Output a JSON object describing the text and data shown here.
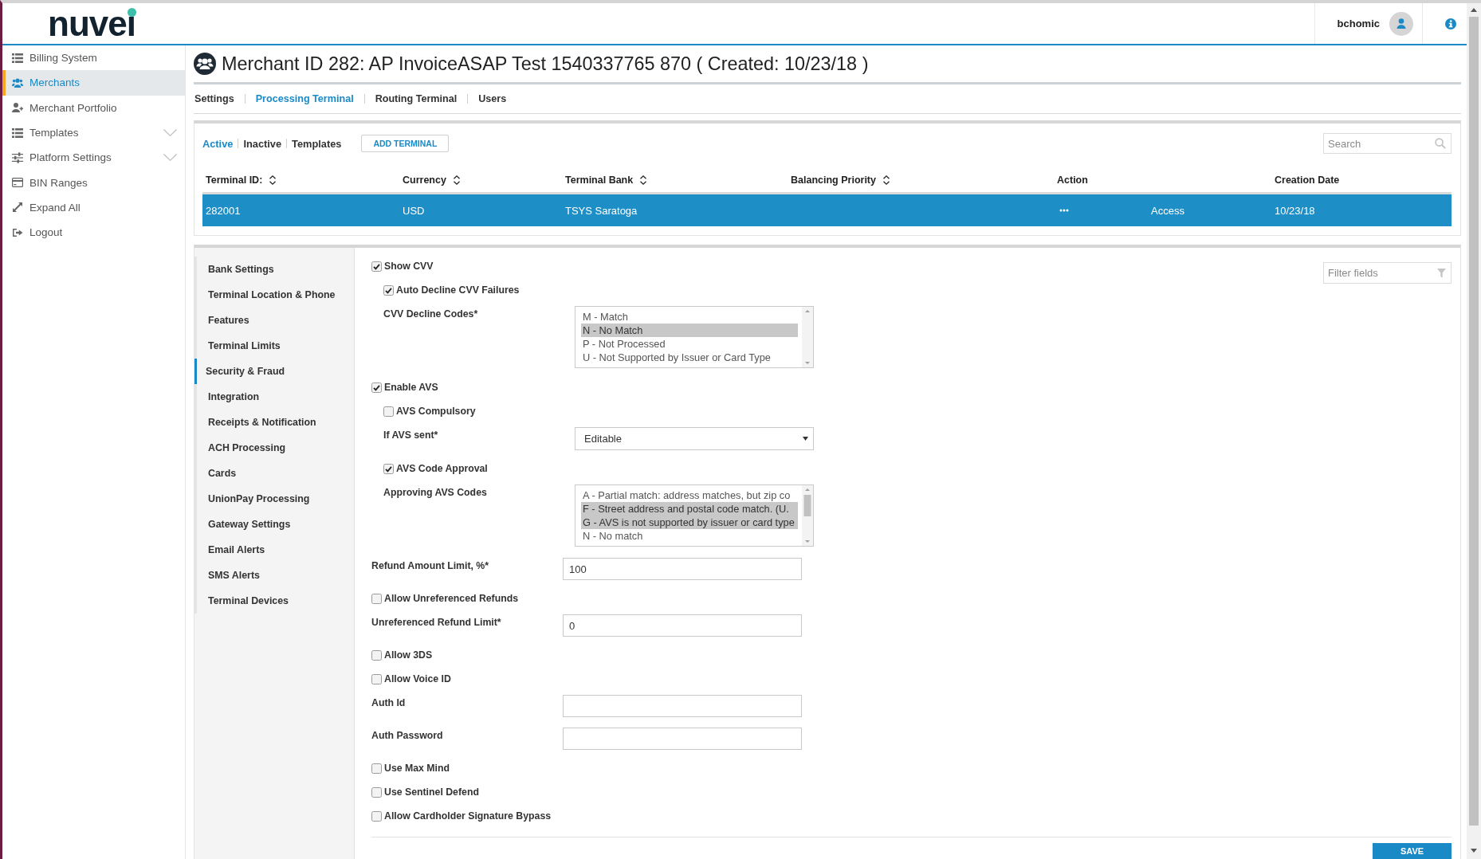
{
  "header": {
    "logo": "nuvei",
    "user": "bchomic"
  },
  "sidebar": {
    "items": [
      {
        "label": "Billing System",
        "selected": false,
        "has_submenu": false
      },
      {
        "label": "Merchants",
        "selected": true,
        "has_submenu": false
      },
      {
        "label": "Merchant Portfolio",
        "selected": false,
        "has_submenu": false
      },
      {
        "label": "Templates",
        "selected": false,
        "has_submenu": true
      },
      {
        "label": "Platform Settings",
        "selected": false,
        "has_submenu": true
      },
      {
        "label": "BIN Ranges",
        "selected": false,
        "has_submenu": false
      },
      {
        "label": "Expand All",
        "selected": false,
        "has_submenu": false
      },
      {
        "label": "Logout",
        "selected": false,
        "has_submenu": false
      }
    ]
  },
  "page": {
    "title": "Merchant ID 282: AP InvoiceASAP Test 1540337765 870 ( Created: 10/23/18 )",
    "tabs": [
      {
        "label": "Settings",
        "selected": false
      },
      {
        "label": "Processing Terminal",
        "selected": true
      },
      {
        "label": "Routing Terminal",
        "selected": false
      },
      {
        "label": "Users",
        "selected": false
      }
    ]
  },
  "terminals": {
    "filters": [
      {
        "label": "Active",
        "selected": true
      },
      {
        "label": "Inactive",
        "selected": false
      },
      {
        "label": "Templates",
        "selected": false
      }
    ],
    "add_button": "ADD TERMINAL",
    "search": {
      "placeholder": "Search"
    },
    "table": {
      "columns": [
        {
          "label": "Terminal ID:",
          "sortable": true
        },
        {
          "label": "Currency",
          "sortable": true
        },
        {
          "label": "Terminal Bank",
          "sortable": true
        },
        {
          "label": "Balancing Priority",
          "sortable": true
        },
        {
          "label": "Action",
          "sortable": false
        },
        {
          "label": "Creation Date",
          "sortable": false
        }
      ],
      "rows": [
        {
          "selected": true,
          "terminal_id": "282001",
          "currency": "USD",
          "terminal_bank": "TSYS Saratoga",
          "action": "Access",
          "creation_date": "10/23/18"
        }
      ]
    }
  },
  "settings": {
    "nav": [
      {
        "label": "Bank Settings",
        "selected": false
      },
      {
        "label": "Terminal Location & Phone",
        "selected": false
      },
      {
        "label": "Features",
        "selected": false
      },
      {
        "label": "Terminal Limits",
        "selected": false
      },
      {
        "label": "Security & Fraud",
        "selected": true
      },
      {
        "label": "Integration",
        "selected": false
      },
      {
        "label": "Receipts & Notification",
        "selected": false
      },
      {
        "label": "ACH Processing",
        "selected": false
      },
      {
        "label": "Cards",
        "selected": false
      },
      {
        "label": "UnionPay Processing",
        "selected": false
      },
      {
        "label": "Gateway Settings",
        "selected": false
      },
      {
        "label": "Email Alerts",
        "selected": false
      },
      {
        "label": "SMS Alerts",
        "selected": false
      },
      {
        "label": "Terminal Devices",
        "selected": false
      }
    ],
    "filter": {
      "placeholder": "Filter fields"
    },
    "fields": [
      {
        "kind": "checkbox",
        "label": "Show CVV",
        "checked": true,
        "children": [
          {
            "kind": "checkbox",
            "label": "Auto Decline CVV Failures",
            "checked": true
          },
          {
            "kind": "listbox",
            "label": "CVV Decline Codes*",
            "options": [
              {
                "text": "M - Match",
                "selected": false
              },
              {
                "text": "N - No Match",
                "selected": true
              },
              {
                "text": "P - Not Processed",
                "selected": false
              },
              {
                "text": "U - Not Supported by Issuer or Card Type",
                "selected": false
              }
            ]
          }
        ]
      },
      {
        "kind": "checkbox",
        "label": "Enable AVS",
        "checked": true,
        "children": [
          {
            "kind": "checkbox",
            "label": "AVS Compulsory",
            "checked": false
          },
          {
            "kind": "select",
            "label": "If AVS sent*",
            "value": "Editable"
          },
          {
            "kind": "checkbox",
            "label": "AVS Code Approval",
            "checked": true
          },
          {
            "kind": "listbox",
            "label": "Approving AVS Codes",
            "options": [
              {
                "text": "A - Partial match: address matches, but zip co",
                "selected": false
              },
              {
                "text": "F - Street address and postal code match. (U.",
                "selected": true
              },
              {
                "text": "G - AVS is not supported by issuer or card type",
                "selected": true
              },
              {
                "text": "N - No match",
                "selected": false
              }
            ]
          }
        ]
      },
      {
        "kind": "text",
        "label": "Refund Amount Limit, %*",
        "value": "100"
      },
      {
        "kind": "checkbox",
        "label": "Allow Unreferenced Refunds",
        "checked": false
      },
      {
        "kind": "text",
        "label": "Unreferenced Refund Limit*",
        "value": "0"
      },
      {
        "kind": "checkbox",
        "label": "Allow 3DS",
        "checked": false
      },
      {
        "kind": "checkbox",
        "label": "Allow Voice ID",
        "checked": false
      },
      {
        "kind": "text",
        "label": "Auth Id"
      },
      {
        "kind": "text",
        "label": "Auth Password"
      },
      {
        "kind": "checkbox",
        "label": "Use Max Mind",
        "checked": false
      },
      {
        "kind": "checkbox",
        "label": "Use Sentinel Defend",
        "checked": false
      },
      {
        "kind": "checkbox",
        "label": "Allow Cardholder Signature Bypass",
        "checked": false
      }
    ],
    "save_button": "SAVE"
  }
}
